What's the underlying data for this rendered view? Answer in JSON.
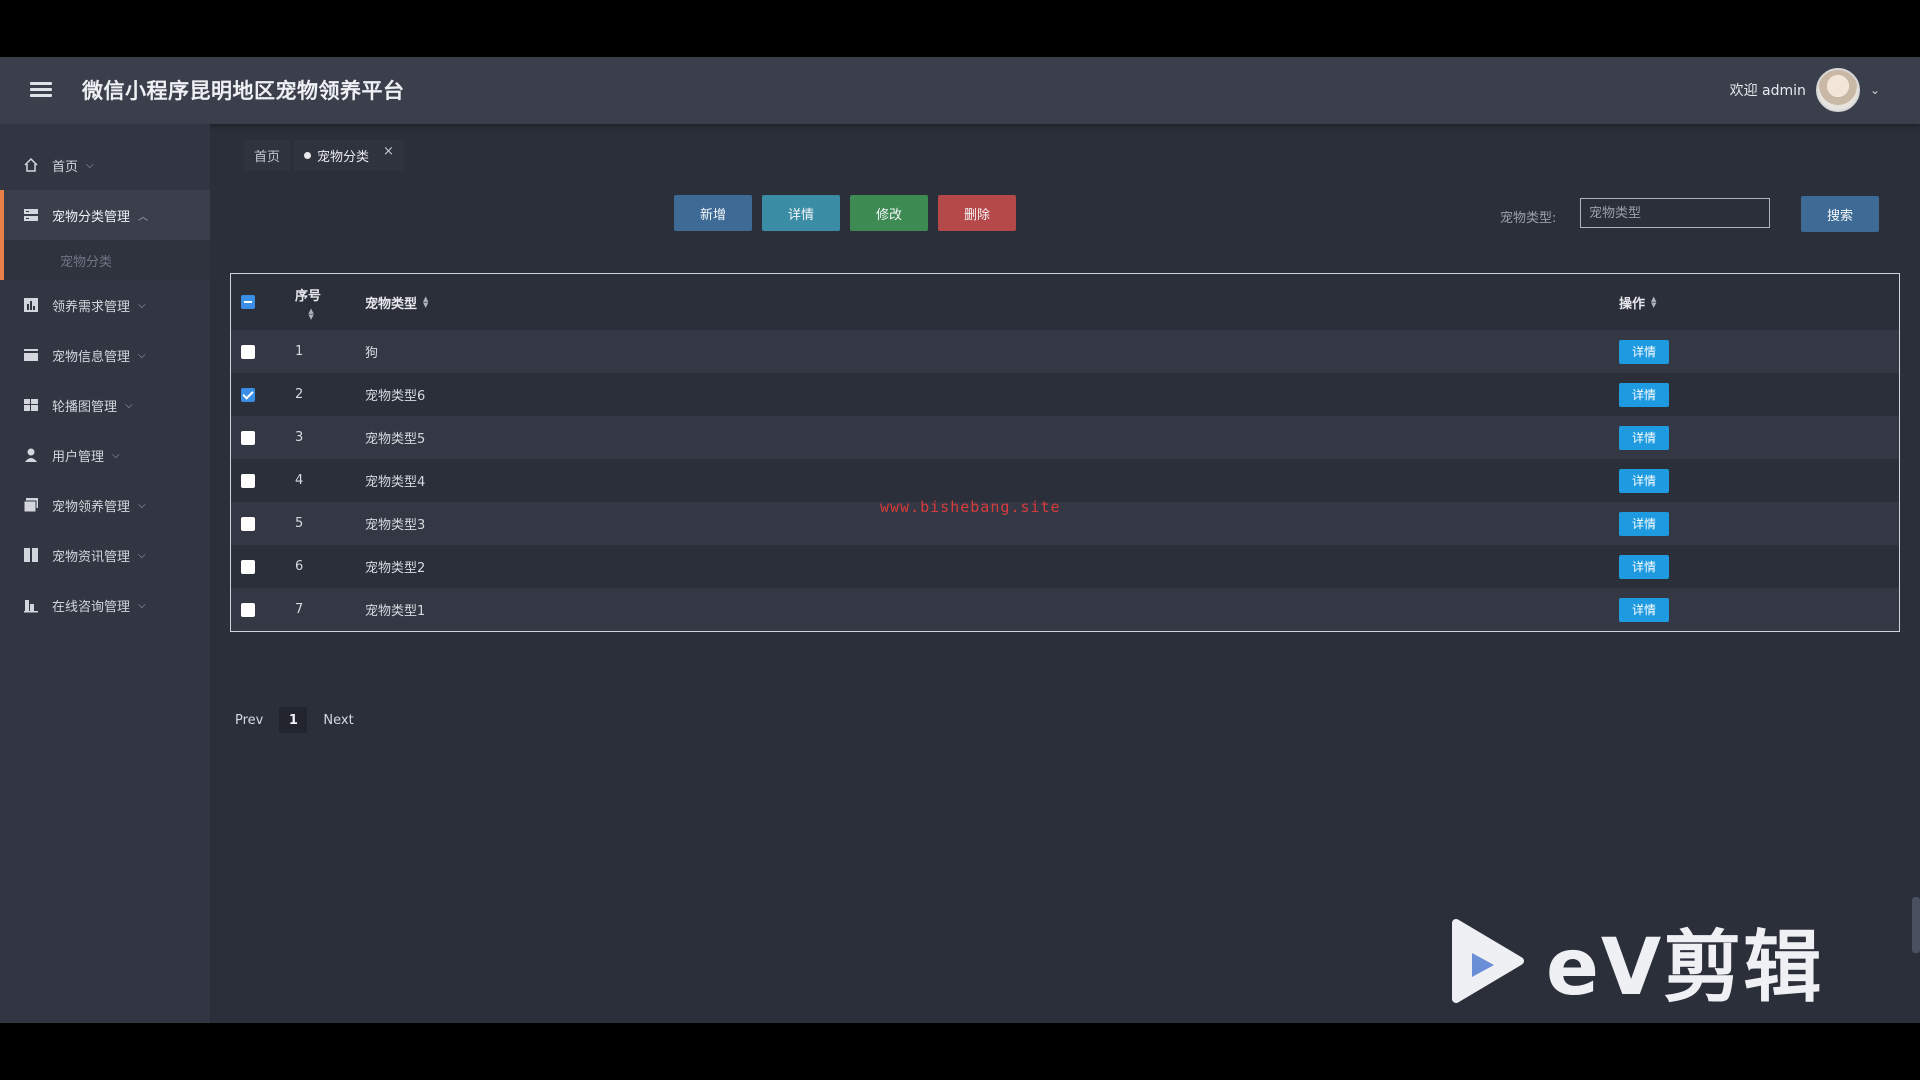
{
  "header": {
    "title": "微信小程序昆明地区宠物领养平台",
    "welcome": "欢迎 admin"
  },
  "sidebar": {
    "items": [
      {
        "label": "首页",
        "icon": "home-icon"
      },
      {
        "label": "宠物分类管理",
        "icon": "server-icon",
        "expanded": true
      },
      {
        "label": "领养需求管理",
        "icon": "chart-icon"
      },
      {
        "label": "宠物信息管理",
        "icon": "card-icon"
      },
      {
        "label": "轮播图管理",
        "icon": "grid-icon"
      },
      {
        "label": "用户管理",
        "icon": "user-icon"
      },
      {
        "label": "宠物领养管理",
        "icon": "image-icon"
      },
      {
        "label": "宠物资讯管理",
        "icon": "columns-icon"
      },
      {
        "label": "在线咨询管理",
        "icon": "bank-icon"
      }
    ],
    "subitem": "宠物分类"
  },
  "tabs": {
    "home": "首页",
    "active": "宠物分类",
    "close": "×"
  },
  "toolbar": {
    "add": "新增",
    "detail": "详情",
    "edit": "修改",
    "delete": "删除"
  },
  "search": {
    "label": "宠物类型:",
    "placeholder": "宠物类型",
    "button": "搜索"
  },
  "table": {
    "headers": {
      "seq": "序号",
      "type": "宠物类型",
      "op": "操作"
    },
    "rows": [
      {
        "seq": "1",
        "type": "狗",
        "checked": false,
        "op": "详情"
      },
      {
        "seq": "2",
        "type": "宠物类型6",
        "checked": true,
        "op": "详情"
      },
      {
        "seq": "3",
        "type": "宠物类型5",
        "checked": false,
        "op": "详情"
      },
      {
        "seq": "4",
        "type": "宠物类型4",
        "checked": false,
        "op": "详情"
      },
      {
        "seq": "5",
        "type": "宠物类型3",
        "checked": false,
        "op": "详情"
      },
      {
        "seq": "6",
        "type": "宠物类型2",
        "checked": false,
        "op": "详情"
      },
      {
        "seq": "7",
        "type": "宠物类型1",
        "checked": false,
        "op": "详情"
      }
    ]
  },
  "watermark": "www.bishebang.site",
  "pagination": {
    "prev": "Prev",
    "page": "1",
    "next": "Next"
  },
  "overlay": {
    "brand": "eV剪辑"
  },
  "colors": {
    "accent": "#e8804a",
    "row_button": "#1e9be0",
    "delete": "#b54848",
    "edit": "#3d8a52"
  }
}
